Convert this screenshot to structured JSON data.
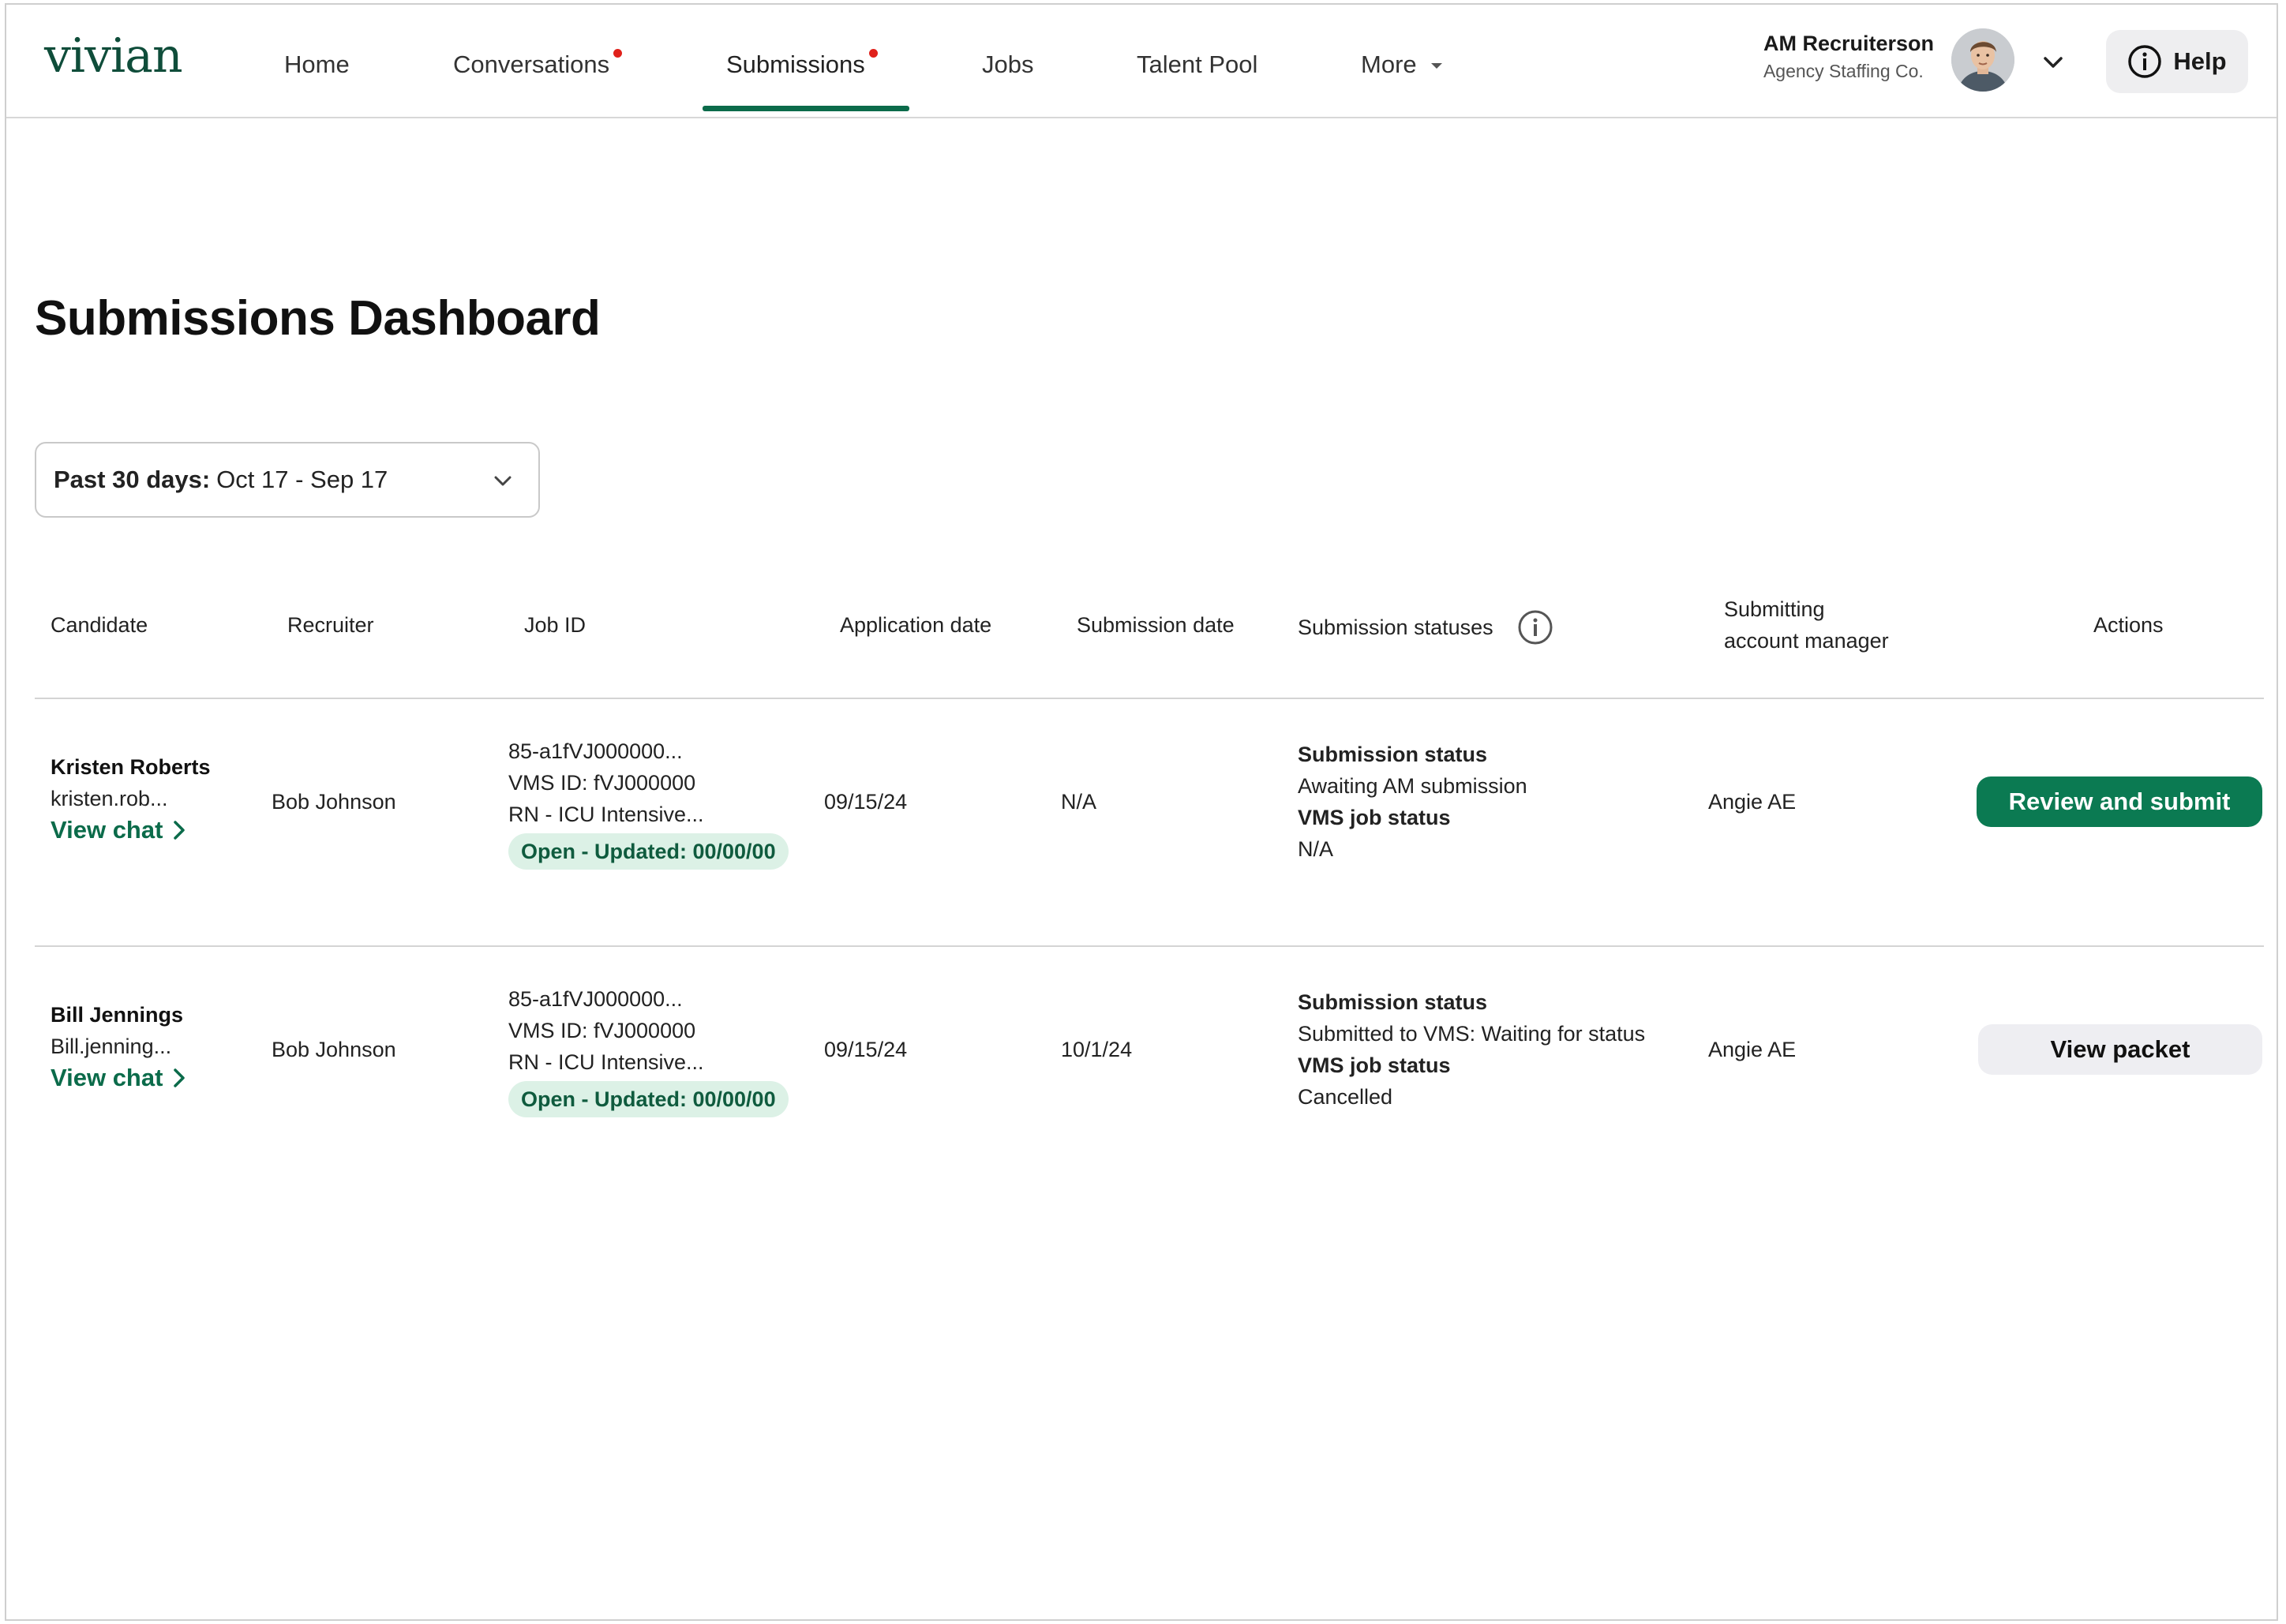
{
  "brand": {
    "logo_text": "vivian",
    "accent": "#0b6b4a",
    "notification_dot": "#e0211b"
  },
  "nav": {
    "items": [
      {
        "label": "Home",
        "has_dot": false,
        "active": false
      },
      {
        "label": "Conversations",
        "has_dot": true,
        "active": false
      },
      {
        "label": "Submissions",
        "has_dot": true,
        "active": true
      },
      {
        "label": "Jobs",
        "has_dot": false,
        "active": false
      },
      {
        "label": "Talent Pool",
        "has_dot": false,
        "active": false
      },
      {
        "label": "More",
        "has_dot": false,
        "active": false
      }
    ],
    "user_name": "AM Recruiterson",
    "user_org": "Agency Staffing Co.",
    "help_label": "Help"
  },
  "page": {
    "title": "Submissions Dashboard",
    "date_filter": {
      "prefix": "Past 30 days:",
      "range": "Oct 17 - Sep 17"
    }
  },
  "table": {
    "headers": {
      "candidate": "Candidate",
      "recruiter": "Recruiter",
      "job_id": "Job ID",
      "application_date": "Application date",
      "submission_date": "Submission date",
      "submission_statuses": "Submission statuses",
      "submitting_am_line1": "Submitting",
      "submitting_am_line2": "account manager",
      "actions": "Actions"
    },
    "rows": [
      {
        "candidate_name": "Kristen Roberts",
        "candidate_email": "kristen.rob...",
        "view_chat": "View chat",
        "recruiter": "Bob Johnson",
        "job_id": "85-a1fVJ000000...",
        "vms_id": "VMS ID: fVJ000000",
        "job_title": "RN - ICU Intensive...",
        "job_pill": "Open - Updated: 00/00/00",
        "application_date": "09/15/24",
        "submission_date": "N/A",
        "submission_status_label": "Submission status",
        "submission_status": "Awaiting AM submission",
        "vms_status_label": "VMS job status",
        "vms_status": "N/A",
        "account_manager": "Angie AE",
        "action": "Review and submit"
      },
      {
        "candidate_name": "Bill Jennings",
        "candidate_email": "Bill.jenning...",
        "view_chat": "View chat",
        "recruiter": "Bob Johnson",
        "job_id": "85-a1fVJ000000...",
        "vms_id": "VMS ID: fVJ000000",
        "job_title": "RN - ICU Intensive...",
        "job_pill": "Open - Updated: 00/00/00",
        "application_date": "09/15/24",
        "submission_date": "10/1/24",
        "submission_status_label": "Submission status",
        "submission_status": "Submitted to VMS: Waiting for status",
        "vms_status_label": "VMS job status",
        "vms_status": "Cancelled",
        "account_manager": "Angie AE",
        "action": "View packet"
      }
    ]
  }
}
